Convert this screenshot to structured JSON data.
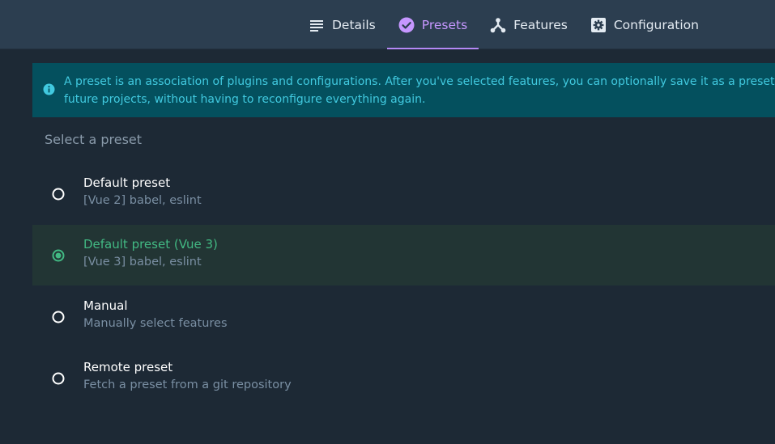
{
  "tabs": [
    {
      "label": "Details",
      "icon": "list-icon"
    },
    {
      "label": "Presets",
      "icon": "check-circle-icon",
      "active": true
    },
    {
      "label": "Features",
      "icon": "fork-icon"
    },
    {
      "label": "Configuration",
      "icon": "gear-icon"
    }
  ],
  "info": {
    "icon": "info-icon",
    "line1": "A preset is an association of plugins and configurations. After you've selected features, you can optionally save it as a preset so that you can reuse it for",
    "line2": "future projects, without having to reconfigure everything again."
  },
  "section_label": "Select a preset",
  "presets": [
    {
      "name": "Default preset",
      "description": "[Vue 2] babel, eslint",
      "selected": false
    },
    {
      "name": "Default preset (Vue 3)",
      "description": "[Vue 3] babel, eslint",
      "selected": true
    },
    {
      "name": "Manual",
      "description": "Manually select features",
      "selected": false
    },
    {
      "name": "Remote preset",
      "description": "Fetch a preset from a git repository",
      "selected": false
    }
  ],
  "colors": {
    "accent_purple": "#c697ff",
    "accent_green": "#42b983",
    "info_bg": "#04505e",
    "info_text": "#41c9df",
    "background": "#1d2935",
    "topbar": "#2c3e50"
  }
}
